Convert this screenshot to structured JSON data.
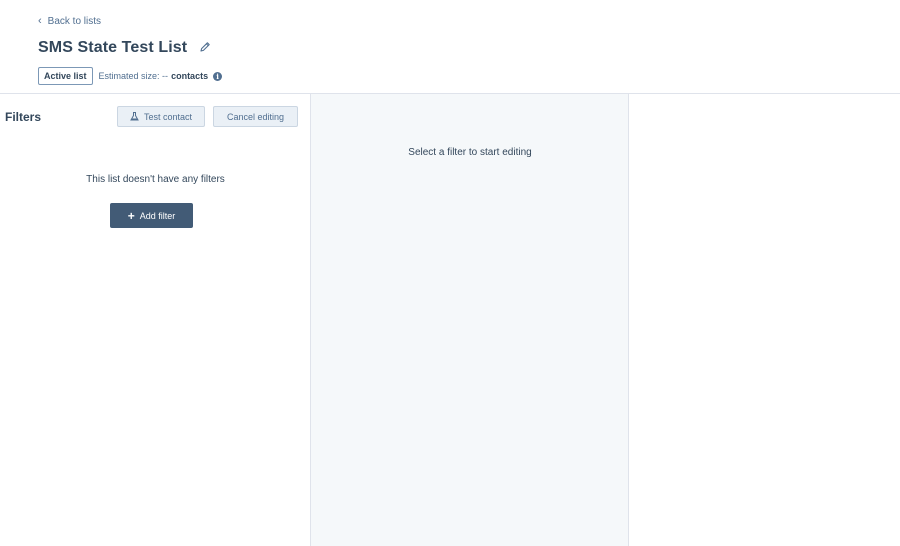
{
  "header": {
    "back_label": "Back to lists",
    "title": "SMS State Test List",
    "badge": "Active list",
    "estimated_label": "Estimated size: --",
    "estimated_unit": "contacts"
  },
  "filters_panel": {
    "heading": "Filters",
    "test_contact_label": "Test contact",
    "cancel_label": "Cancel editing",
    "empty_message": "This list doesn't have any filters",
    "add_filter_label": "Add filter"
  },
  "editor_panel": {
    "message": "Select a filter to start editing"
  },
  "icons": {
    "back": "chevron-left-icon",
    "edit": "pencil-icon",
    "info": "info-icon",
    "test": "flask-icon",
    "add": "plus-icon"
  },
  "colors": {
    "primary_text": "#33475b",
    "secondary_text": "#516f90",
    "primary_button": "#425b76",
    "secondary_button": "#eaf0f6",
    "panel_bg": "#f5f8fa",
    "border": "#dfe3eb"
  }
}
